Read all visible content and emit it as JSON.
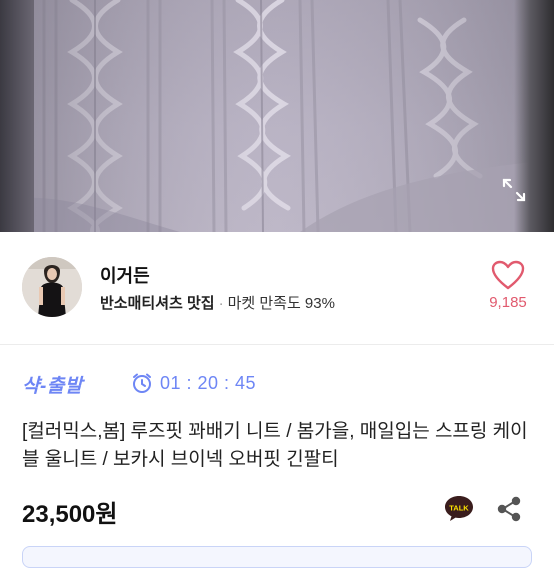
{
  "product_image": {
    "icon": "expand-icon"
  },
  "seller": {
    "name": "이거든",
    "category": "반소매티셔츠 맛집",
    "separator": "·",
    "satisfaction": "마켓 만족도 93%",
    "likes": "9,185",
    "like_icon": "heart-icon"
  },
  "promo": {
    "badge": "샥-출발",
    "timer": "01 : 20 : 45",
    "color": "#6e86f5"
  },
  "product": {
    "title": "[컬러믹스,봄] 루즈핏 꽈배기 니트 / 봄가을, 매일입는 스프링 케이블 울니트 / 보카시 브이넥 오버핏 긴팔티",
    "price": "23,500원"
  },
  "actions": {
    "talk_label": "TALK",
    "share_icon": "share-icon"
  },
  "colors": {
    "accent": "#6e86f5",
    "heart": "#e15a6e",
    "talk_bg": "#3a1d1d",
    "talk_yellow": "#fee500"
  }
}
